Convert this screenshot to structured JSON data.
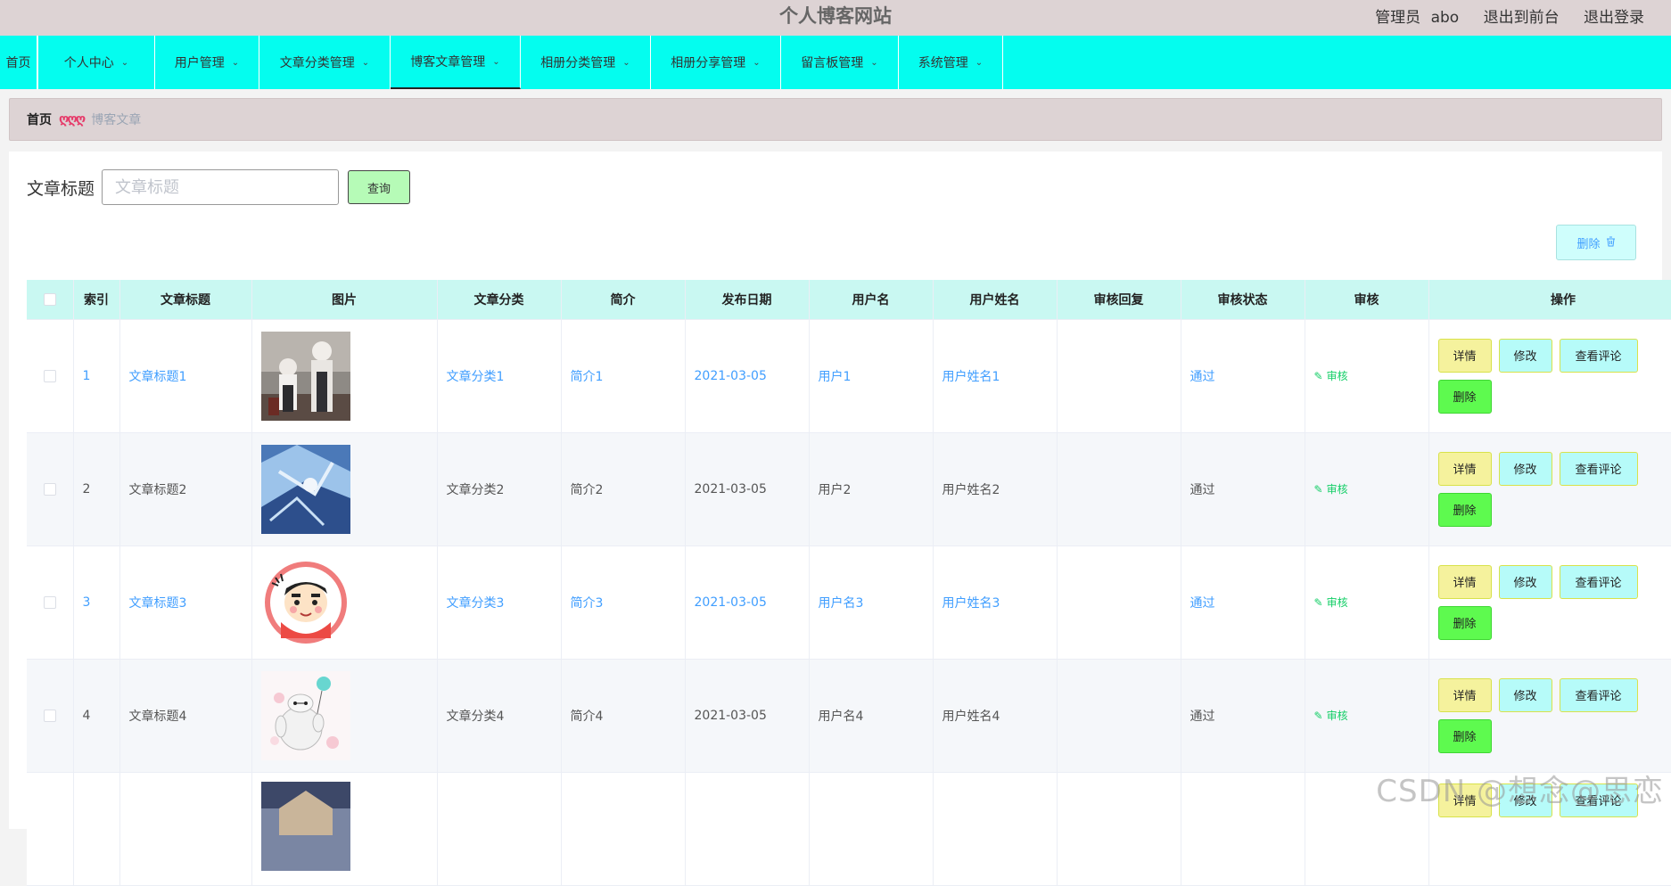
{
  "header": {
    "site_title": "个人博客网站",
    "admin_label": "管理员",
    "admin_name": "abo",
    "to_front": "退出到前台",
    "logout": "退出登录"
  },
  "nav": {
    "home": "首页",
    "items": [
      {
        "label": "个人中心"
      },
      {
        "label": "用户管理"
      },
      {
        "label": "文章分类管理"
      },
      {
        "label": "博客文章管理"
      },
      {
        "label": "相册分类管理"
      },
      {
        "label": "相册分享管理"
      },
      {
        "label": "留言板管理"
      },
      {
        "label": "系统管理"
      }
    ],
    "active": "博客文章管理"
  },
  "breadcrumb": {
    "home": "首页",
    "separator": "ღღღ",
    "current": "博客文章"
  },
  "search": {
    "label": "文章标题",
    "placeholder": "文章标题",
    "value": "",
    "query_button": "查询"
  },
  "batch_delete": "删除",
  "table": {
    "headers": [
      "索引",
      "文章标题",
      "图片",
      "文章分类",
      "简介",
      "发布日期",
      "用户名",
      "用户姓名",
      "审核回复",
      "审核状态",
      "审核",
      "操作"
    ],
    "rows": [
      {
        "index": "1",
        "title": "文章标题1",
        "image": "anime-duo-illustration",
        "category": "文章分类1",
        "summary": "简介1",
        "date": "2021-03-05",
        "username": "用户1",
        "realname": "用户姓名1",
        "reply": "",
        "status": "通过",
        "audit": "审核"
      },
      {
        "index": "2",
        "title": "文章标题2",
        "image": "blue-ice-anime-illustration",
        "category": "文章分类2",
        "summary": "简介2",
        "date": "2021-03-05",
        "username": "用户2",
        "realname": "用户姓名2",
        "reply": "",
        "status": "通过",
        "audit": "审核"
      },
      {
        "index": "3",
        "title": "文章标题3",
        "image": "crayon-shinchan-avatar",
        "category": "文章分类3",
        "summary": "简介3",
        "date": "2021-03-05",
        "username": "用户名3",
        "realname": "用户姓名3",
        "reply": "",
        "status": "通过",
        "audit": "审核"
      },
      {
        "index": "4",
        "title": "文章标题4",
        "image": "baymax-balloon-drawing",
        "category": "文章分类4",
        "summary": "简介4",
        "date": "2021-03-05",
        "username": "用户名4",
        "realname": "用户姓名4",
        "reply": "",
        "status": "通过",
        "audit": "审核"
      },
      {
        "index": "",
        "title": "",
        "image": "anime-portrait-partial",
        "category": "",
        "summary": "",
        "date": "",
        "username": "",
        "realname": "",
        "reply": "",
        "status": "",
        "audit": ""
      }
    ],
    "actions": {
      "detail": "详情",
      "edit": "修改",
      "comments": "查看评论",
      "delete": "删除"
    }
  },
  "watermark": "CSDN @想念@思恋",
  "colors": {
    "nav_bg": "#04fdef",
    "header_bg": "#ddd3d4",
    "table_header_bg": "#c9f8f2",
    "link_blue": "#409eff",
    "detail_btn": "#f5f29d",
    "edit_btn": "#b6fbf9",
    "delete_btn": "#5efa4f",
    "audit_green": "#13ce66"
  },
  "icons": {
    "chevron": "chevron-down-icon",
    "trash": "trash-icon",
    "audit": "edit-pen-icon"
  }
}
